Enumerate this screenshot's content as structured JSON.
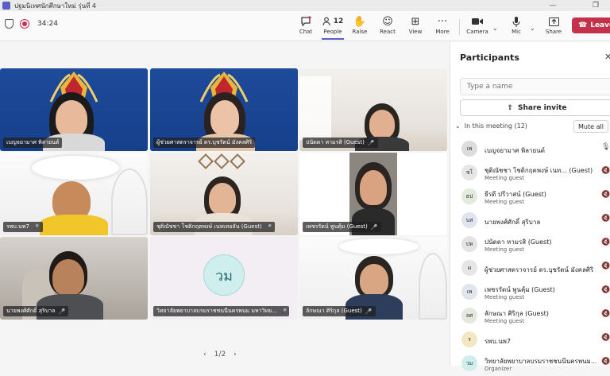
{
  "window": {
    "title": "ปฐมนิเทศนักศึกษาใหม่ รุ่นที่ 4"
  },
  "topbar": {
    "timer": "34:24",
    "buttons": [
      {
        "id": "chat",
        "label": "Chat",
        "icon": "chat-icon"
      },
      {
        "id": "people",
        "label": "People",
        "icon": "people-icon",
        "count": "12"
      },
      {
        "id": "raise",
        "label": "Raise",
        "icon": "hand-icon"
      },
      {
        "id": "react",
        "label": "React",
        "icon": "smile-icon"
      },
      {
        "id": "view",
        "label": "View",
        "icon": "grid-icon"
      },
      {
        "id": "more",
        "label": "More",
        "icon": "more-icon"
      },
      {
        "id": "camera",
        "label": "Camera",
        "icon": "camera-icon"
      },
      {
        "id": "mic",
        "label": "Mic",
        "icon": "mic-icon"
      },
      {
        "id": "share",
        "label": "Share",
        "icon": "share-icon"
      }
    ],
    "leave_label": "Leave"
  },
  "stage": {
    "tiles": [
      {
        "name": "เบญจยามาศ พิลายนต์"
      },
      {
        "name": "ผู้ช่วยศาสตราจารย์ ดร.บุชรัตน์ มังคลศิริ"
      },
      {
        "name": "ปนัดดา หามรสิ (Guest)"
      },
      {
        "name": "รพบ.นพ7"
      },
      {
        "name": "ชุติณัชชา โชติกฤตพงษ์ เนทเทอลัน (Guest)"
      },
      {
        "name": "เพชรรัตน์ พูนคุ้ม (Guest)"
      },
      {
        "name": "นายพงศ์ศักดิ์ สุริบาล"
      },
      {
        "name": "วิทยาลัยพยาบาลบรมราชชนนีนครพนม มหาวิทย...",
        "initials": "วม"
      },
      {
        "name": "ลักษณา ศิริกุล (Guest)"
      }
    ],
    "pager": {
      "prev": "‹",
      "page": "1/2",
      "next": "›"
    }
  },
  "panel": {
    "title": "Participants",
    "search_placeholder": "Type a name",
    "share_invite": "Share invite",
    "section_label": "In this meeting (12)",
    "mute_all": "Mute all",
    "participants": [
      {
        "initials": "เพ",
        "name": "เบญจยามาศ พิลายนต์",
        "sub": "",
        "color": "#dcdcdc"
      },
      {
        "initials": "ชโ",
        "name": "ชุติณัชชา โชติกฤตพงษ์ เนท...  (Guest)",
        "sub": "Meeting guest",
        "color": "#e6e6e6"
      },
      {
        "initials": "ธป",
        "name": "ธีรดี ปรีวาสน์ (Guest)",
        "sub": "Meeting guest",
        "color": "#e2ebdc"
      },
      {
        "initials": "นส",
        "name": "นายพงศ์ศักดิ์ สุริบาล",
        "sub": "",
        "color": "#dfe4f0"
      },
      {
        "initials": "ปห",
        "name": "ปนัดดา หามรสิ (Guest)",
        "sub": "Meeting guest",
        "color": "#e4e4e4"
      },
      {
        "initials": "ผ",
        "name": "ผู้ช่วยศาสตราจารย์ ดร.บุชรัตน์ มังคลศิริ",
        "sub": "",
        "color": "#e6e6e6"
      },
      {
        "initials": "เพ",
        "name": "เพชรรัตน์ พูนคุ้ม (Guest)",
        "sub": "Meeting guest",
        "color": "#dfe6ee"
      },
      {
        "initials": "ลศ",
        "name": "ลักษณา ศิริกุล (Guest)",
        "sub": "Meeting guest",
        "color": "#e4e8de"
      },
      {
        "initials": "ร",
        "name": "รพบ.นพ7",
        "sub": "",
        "color": "#f3e6c2"
      },
      {
        "initials": "วม",
        "name": "วิทยาลัยพยาบาลบรมราชชนนีนครพนม...",
        "sub": "Organizer",
        "color": "#cfeeee"
      }
    ]
  }
}
